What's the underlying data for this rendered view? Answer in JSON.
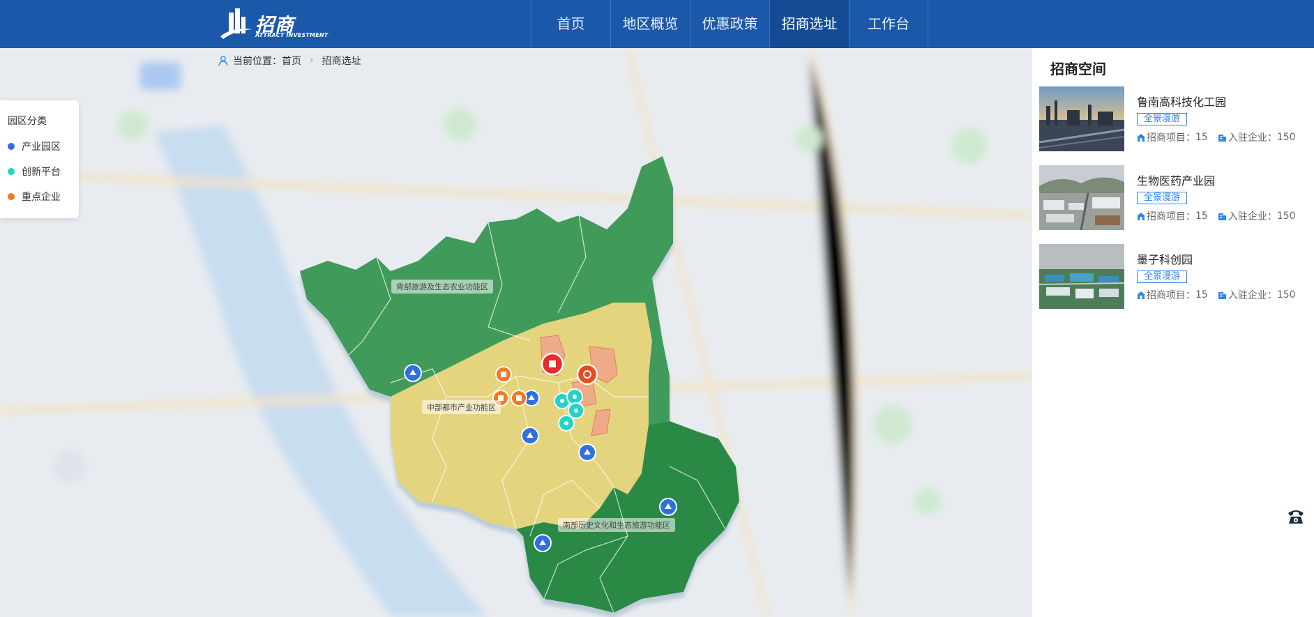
{
  "header": {
    "logo_cn": "招商",
    "logo_en": "ATTRACT INVESTMENT",
    "nav": [
      {
        "label": "首页"
      },
      {
        "label": "地区概览"
      },
      {
        "label": "优惠政策"
      },
      {
        "label": "招商选址",
        "active": true
      },
      {
        "label": "工作台"
      }
    ],
    "bg_color": "#1c58aa",
    "active_color": "#134b95"
  },
  "breadcrumb": {
    "prefix": "当前位置：",
    "home": "首页",
    "current": "招商选址"
  },
  "legend": {
    "title": "园区分类",
    "items": [
      {
        "label": "产业园区",
        "color": "#2f6fe0"
      },
      {
        "label": "创新平台",
        "color": "#22d3c8"
      },
      {
        "label": "重点企业",
        "color": "#f07a22"
      }
    ]
  },
  "zones": {
    "north": "背部旅游及生态农业功能区",
    "central": "中部都市产业功能区",
    "south": "南部历史文化和生态旅游功能区"
  },
  "panel": {
    "title": "招商空间",
    "spaces": [
      {
        "name": "鲁南高科技化工园",
        "tag": "全景漫游",
        "projects_label": "招商项目：",
        "projects": "15",
        "companies_label": "入驻企业：",
        "companies": "150"
      },
      {
        "name": "生物医药产业园",
        "tag": "全景漫游",
        "projects_label": "招商项目：",
        "projects": "15",
        "companies_label": "入驻企业：",
        "companies": "150"
      },
      {
        "name": "墨子科创园",
        "tag": "全景漫游",
        "projects_label": "招商项目：",
        "projects": "15",
        "companies_label": "入驻企业：",
        "companies": "150"
      }
    ]
  },
  "icons": {
    "breadcrumb": "location-person-icon",
    "phone": "phone-icon"
  }
}
